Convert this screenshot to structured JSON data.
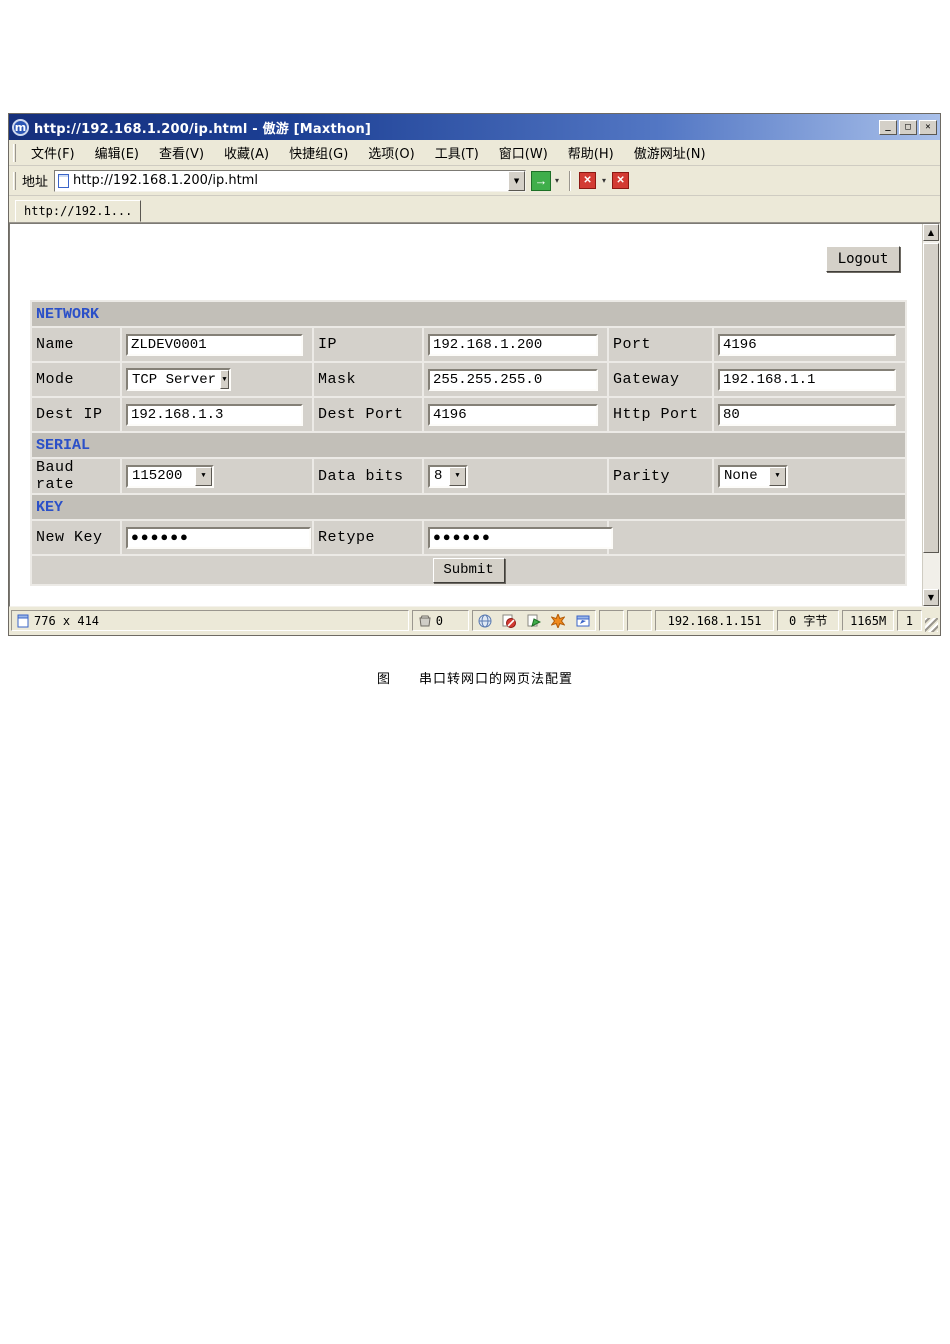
{
  "window": {
    "title": "http://192.168.1.200/ip.html - 傲游 [Maxthon]",
    "logo_letter": "m",
    "controls": {
      "minimize": "_",
      "maximize": "□",
      "close": "✕"
    }
  },
  "menu": {
    "items": [
      "文件(F)",
      "编辑(E)",
      "查看(V)",
      "收藏(A)",
      "快捷组(G)",
      "选项(O)",
      "工具(T)",
      "窗口(W)",
      "帮助(H)",
      "傲游网址(N)"
    ]
  },
  "address_bar": {
    "label": "地址",
    "url": "http://192.168.1.200/ip.html"
  },
  "tabs": [
    {
      "label": "http://192.1..."
    }
  ],
  "glyphs": {
    "dropdown": "▼",
    "dropdown_small": "▾",
    "up": "▲",
    "go": "→",
    "close_x": "✕"
  },
  "page": {
    "logout_label": "Logout"
  },
  "form": {
    "network_header": "NETWORK",
    "serial_header": "SERIAL",
    "key_header": "KEY",
    "fields": {
      "name": {
        "label": "Name",
        "value": "ZLDEV0001"
      },
      "ip": {
        "label": "IP",
        "value": "192.168.1.200"
      },
      "port": {
        "label": "Port",
        "value": "4196"
      },
      "mode": {
        "label": "Mode",
        "value": "TCP Server"
      },
      "mask": {
        "label": "Mask",
        "value": "255.255.255.0"
      },
      "gateway": {
        "label": "Gateway",
        "value": "192.168.1.1"
      },
      "dest_ip": {
        "label": "Dest IP",
        "value": "192.168.1.3"
      },
      "dest_port": {
        "label": "Dest Port",
        "value": "4196"
      },
      "http_port": {
        "label": "Http Port",
        "value": "80"
      },
      "baud_rate": {
        "label": "Baud rate",
        "value": "115200"
      },
      "data_bits": {
        "label": "Data bits",
        "value": "8"
      },
      "parity": {
        "label": "Parity",
        "value": "None"
      },
      "new_key": {
        "label": "New Key",
        "value": "●●●●●●"
      },
      "retype": {
        "label": "Retype",
        "value": "●●●●●●"
      }
    },
    "submit_label": "Submit"
  },
  "status_bar": {
    "page_size": "776 x 414",
    "popup_count": "0",
    "ip": "192.168.1.151",
    "bytes": "0 字节",
    "memory": "1165M",
    "tab_count": "1"
  },
  "caption": "图　　串口转网口的网页法配置",
  "colors": {
    "title_blue": "#1c3f94",
    "section_header_blue": "#2b50c8",
    "go_green": "#3fae4a",
    "stop_red": "#d33b33",
    "chrome_gray": "#ece9d8"
  }
}
